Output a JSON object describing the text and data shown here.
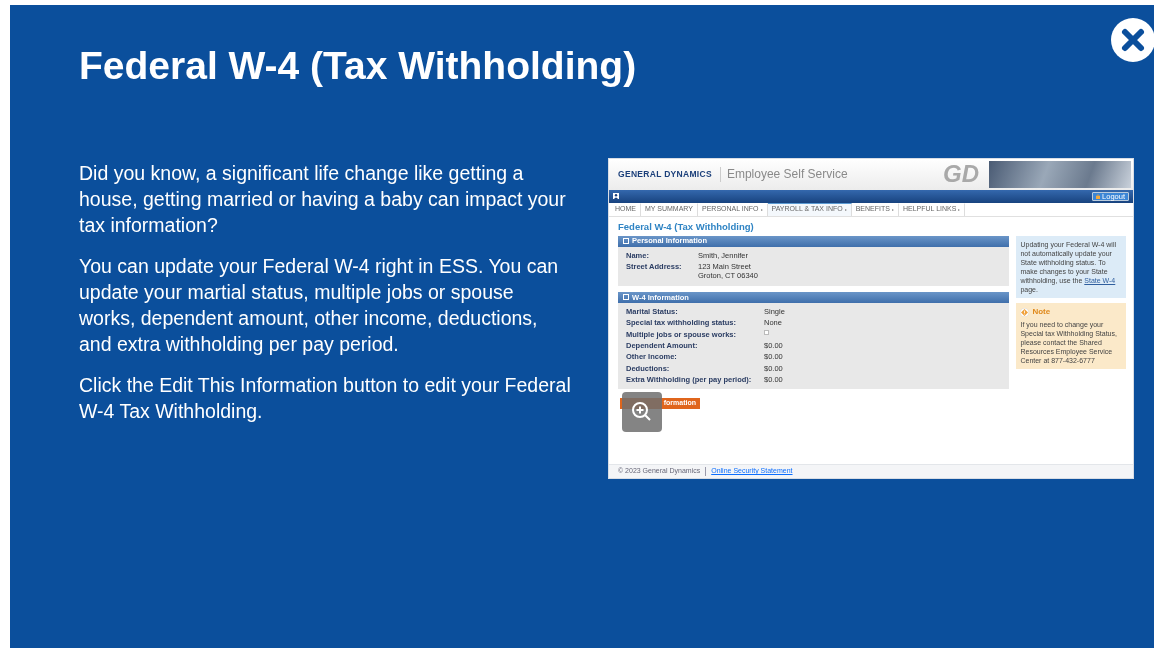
{
  "slide": {
    "title": "Federal W-4 (Tax Withholding)",
    "paragraphs": [
      "Did you know, a significant life change like getting a house, getting married or having a baby can impact your tax information?",
      "You can update your Federal W-4 right in ESS. You can update your martial status, multiple jobs or spouse works, dependent amount, other income, deductions, and extra withholding per pay period.",
      "Click the Edit This Information button to edit your Federal W-4 Tax Withholding."
    ]
  },
  "screenshot": {
    "brand": "GENERAL DYNAMICS",
    "app_title": "Employee Self Service",
    "logo_mark": "GD",
    "logout": "Logout",
    "nav": [
      {
        "label": "HOME",
        "has_menu": false,
        "selected": false
      },
      {
        "label": "MY SUMMARY",
        "has_menu": false,
        "selected": false
      },
      {
        "label": "PERSONAL INFO",
        "has_menu": true,
        "selected": false
      },
      {
        "label": "PAYROLL & TAX INFO",
        "has_menu": true,
        "selected": true
      },
      {
        "label": "BENEFITS",
        "has_menu": true,
        "selected": false
      },
      {
        "label": "HELPFUL LINKS",
        "has_menu": true,
        "selected": false
      }
    ],
    "page_title": "Federal W-4 (Tax Withholding)",
    "sections": [
      {
        "title": "Personal Information",
        "fields": [
          {
            "kind": "text",
            "label": "Name:",
            "value": "Smith, Jennifer"
          },
          {
            "kind": "text",
            "label": "Street Address:",
            "value": "123 Main Street\nGroton, CT 06340"
          }
        ]
      },
      {
        "title": "W-4 Information",
        "fields": [
          {
            "kind": "text",
            "label": "Marital Status:",
            "value": "Single"
          },
          {
            "kind": "text",
            "label": "Special tax withholding status:",
            "value": "None"
          },
          {
            "kind": "checkbox",
            "label": "Multiple jobs or spouse works:",
            "checked": false
          },
          {
            "kind": "text",
            "label": "Dependent Amount:",
            "value": "$0.00"
          },
          {
            "kind": "text",
            "label": "Other Income:",
            "value": "$0.00"
          },
          {
            "kind": "text",
            "label": "Deductions:",
            "value": "$0.00"
          },
          {
            "kind": "text",
            "label": "Extra Withholding (per pay period):",
            "value": "$0.00"
          }
        ]
      }
    ],
    "info_box": {
      "text": "Updating your Federal W-4 will not automatically update your State withholding status. To make changes to your State withholding, use the",
      "link": "State W-4",
      "text_after": "page."
    },
    "note": {
      "title": "Note",
      "text": "If you need to change your Special tax Withholding Status, please contact the Shared Resources Employee Service Center at 877-432-6777"
    },
    "edit_button": "formation",
    "footer": {
      "copyright": "© 2023 General Dynamics",
      "link": "Online Security Statement"
    }
  }
}
